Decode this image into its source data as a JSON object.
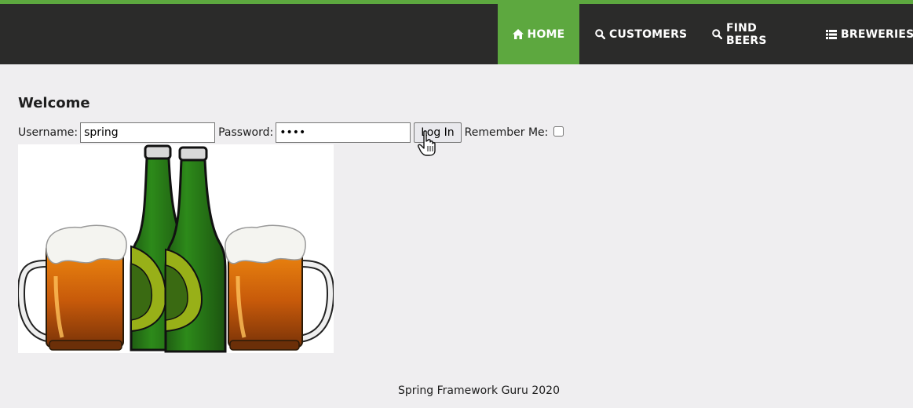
{
  "nav": {
    "items": [
      {
        "label": "HOME",
        "icon": "home-icon",
        "active": true
      },
      {
        "label": "CUSTOMERS",
        "icon": "search-icon",
        "active": false
      },
      {
        "label": "FIND BEERS",
        "icon": "search-icon",
        "active": false
      },
      {
        "label": "BREWERIES",
        "icon": "list-icon",
        "active": false
      }
    ],
    "active_color": "#5da83f",
    "bar_color": "#2b2b2a"
  },
  "main": {
    "heading": "Welcome",
    "form": {
      "username_label": "Username:",
      "username_value": "spring",
      "password_label": "Password:",
      "password_value": "guru",
      "login_label": "Log In",
      "remember_label": "Remember Me:",
      "remember_checked": false
    },
    "image": "beer-mugs-and-bottles-illustration"
  },
  "footer": {
    "text": "Spring Framework Guru 2020"
  }
}
